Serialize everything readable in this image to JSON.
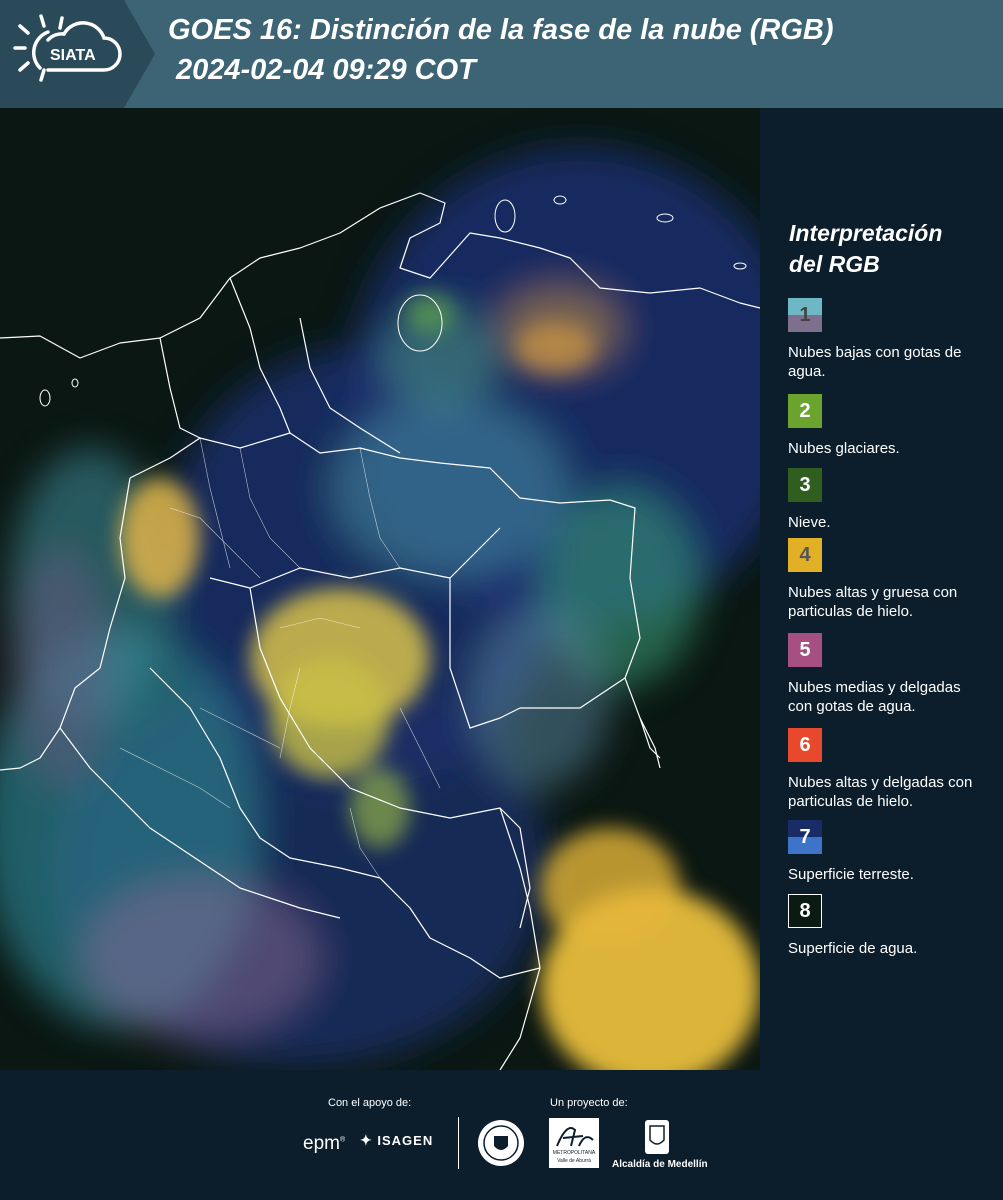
{
  "header": {
    "logo_text": "SIATA",
    "title_line1": "GOES 16: Distinción de la fase de la nube (RGB)",
    "title_line2": "2024-02-04 09:29 COT"
  },
  "legend": {
    "title_line1": "Interpretación",
    "title_line2": "del RGB",
    "items": [
      {
        "num": "1",
        "label": "Nubes bajas con gotas de agua.",
        "color": "#6fb7c5",
        "color2": "#7e6f8f"
      },
      {
        "num": "2",
        "label": "Nubes glaciares.",
        "color": "#6aa42e"
      },
      {
        "num": "3",
        "label": "Nieve.",
        "color": "#2f5e1e"
      },
      {
        "num": "4",
        "label": "Nubes altas y gruesa con particulas de hielo.",
        "color": "#e1b024"
      },
      {
        "num": "5",
        "label": "Nubes medias y delgadas con gotas de agua.",
        "color": "#a54f82"
      },
      {
        "num": "6",
        "label": "Nubes altas y delgadas con particulas de hielo.",
        "color": "#e8492c"
      },
      {
        "num": "7",
        "label": "Superficie terreste.",
        "color": "#1a2c66",
        "color2": "#3d73c9"
      },
      {
        "num": "8",
        "label": "Superficie de agua.",
        "color": "#0b1a12"
      }
    ]
  },
  "footer": {
    "support_label": "Con el apoyo de:",
    "project_label": "Un proyecto de:",
    "epm_logo": "epm",
    "isagen_logo": "ISAGEN",
    "metro_line1": "METROPOLITANA",
    "metro_line2": "Valle de Aburrá",
    "alcaldia": "Alcaldía de Medellín"
  }
}
